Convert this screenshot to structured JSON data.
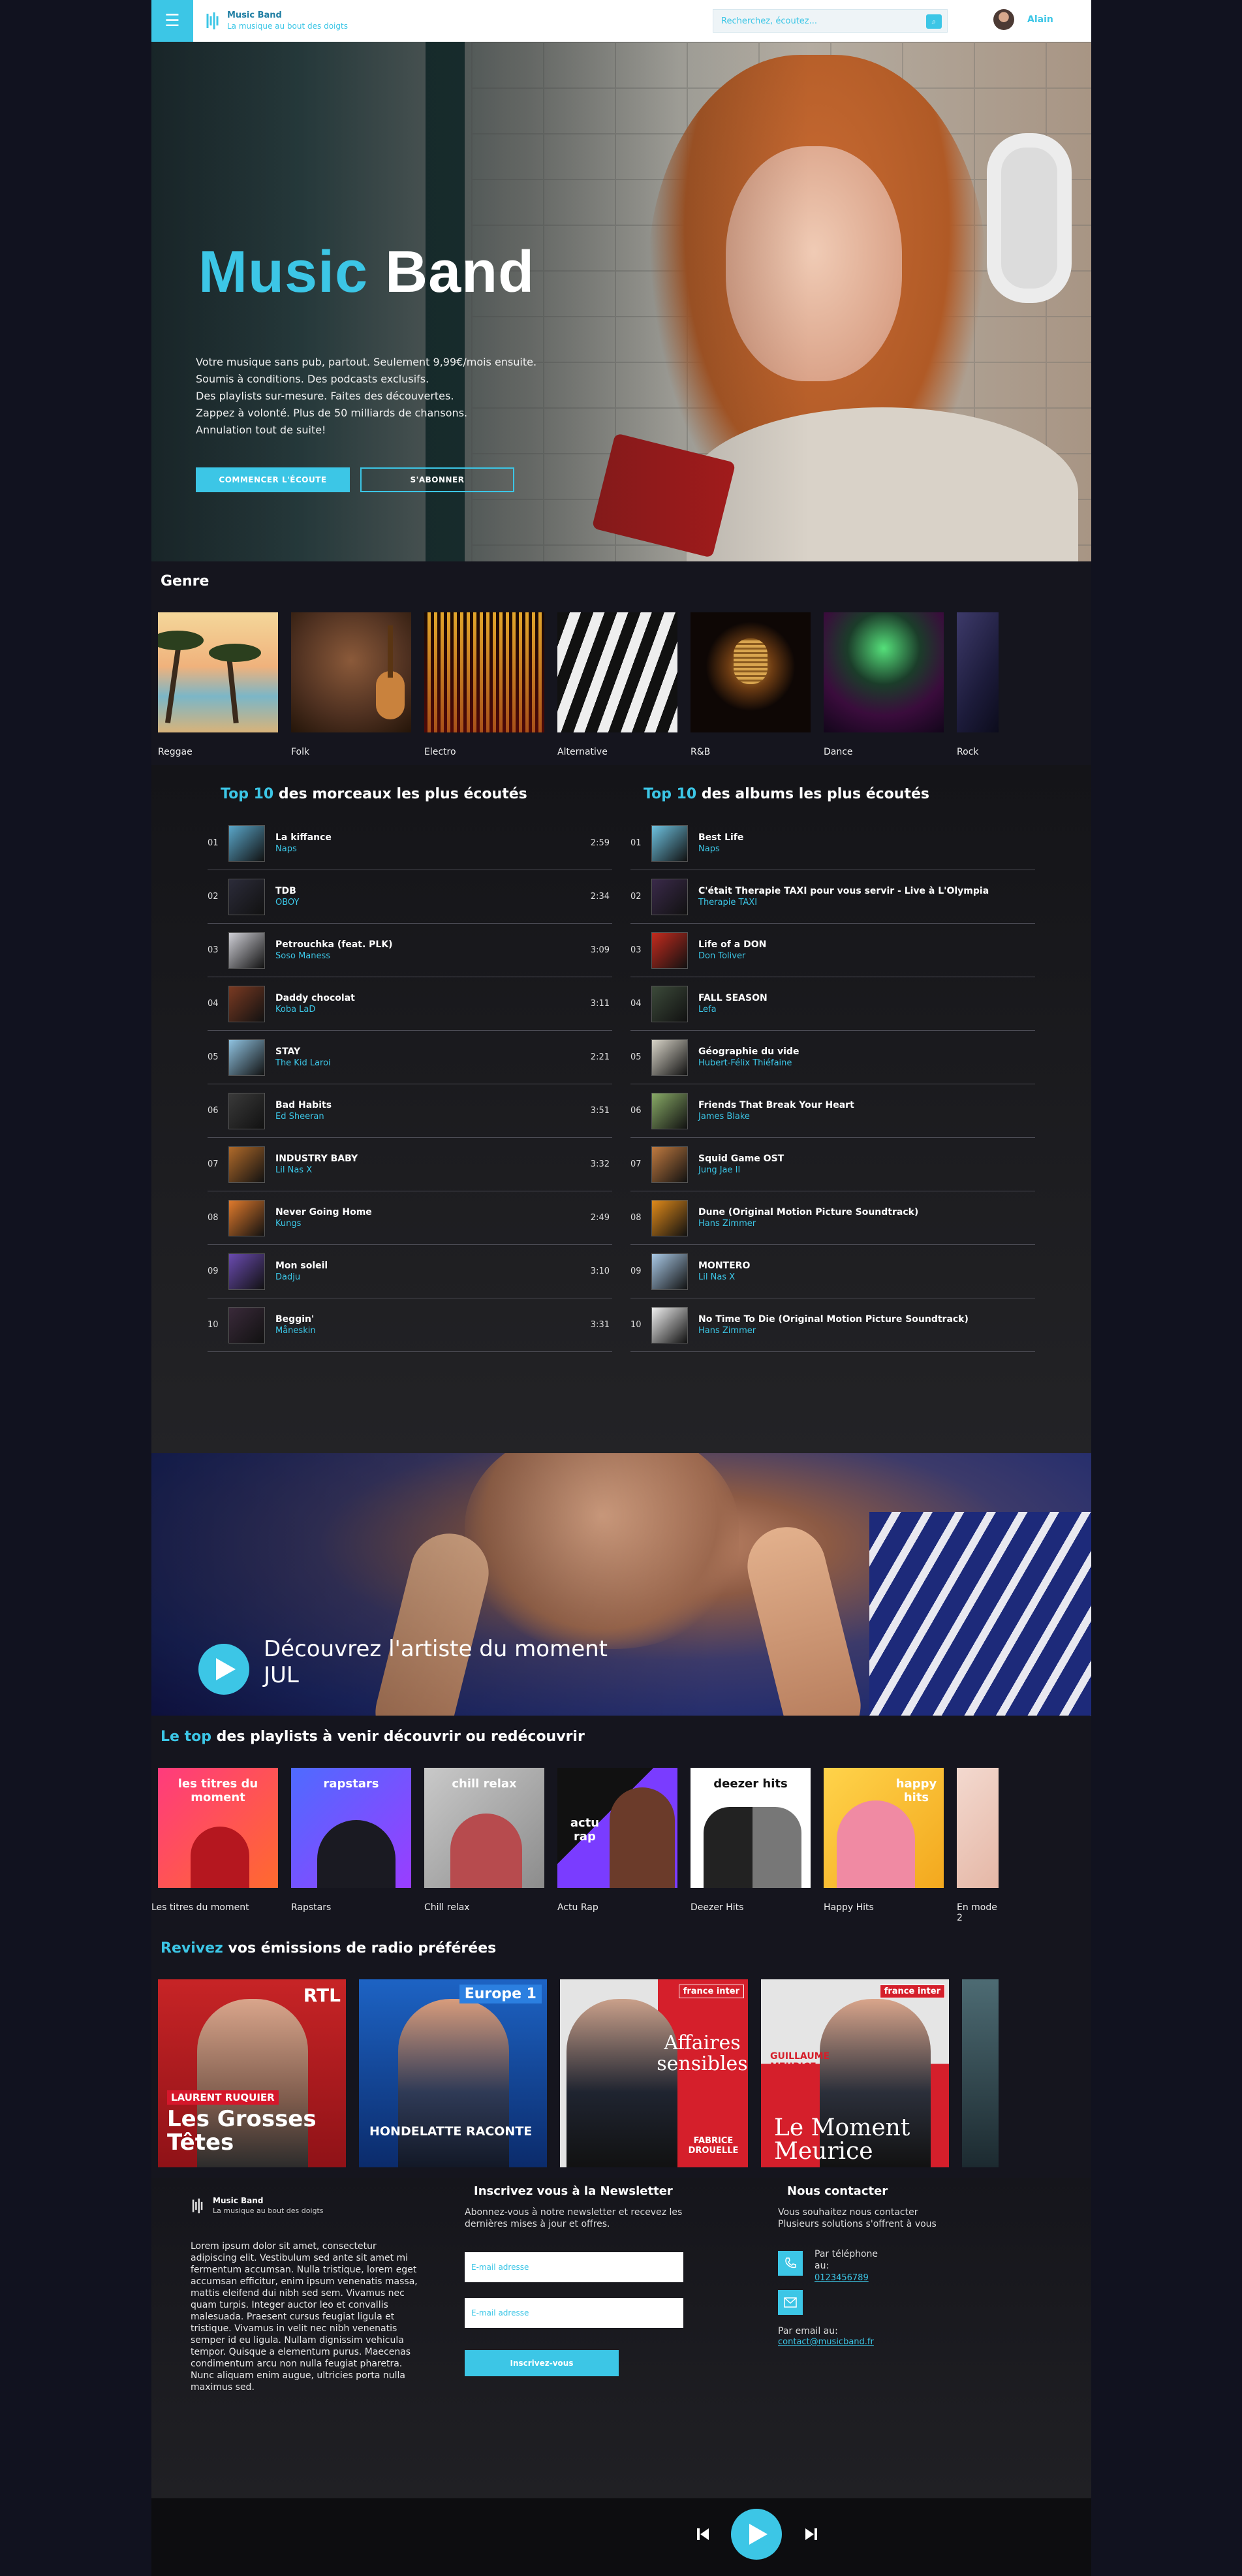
{
  "header": {
    "menu_icon": "hamburger-icon",
    "logo_title": "Music Band",
    "logo_subtitle": "La musique au bout des doigts",
    "search_placeholder": "Recherchez, écoutez...",
    "user_name": "Alain",
    "accent": "#3cc6e6"
  },
  "hero": {
    "title_part1": "Music",
    "title_part2": "Band",
    "lines": [
      "Votre musique sans pub, partout. Seulement 9,99€/mois ensuite.",
      "Soumis à conditions. Des podcasts exclusifs.",
      "Des playlists sur-mesure. Faites des découvertes.",
      "Zappez à volonté. Plus de 50 milliards de chansons.",
      "Annulation tout de suite!"
    ],
    "btn_listen": "COMMENCER L'ÉCOUTE",
    "btn_subscribe": "S'ABONNER"
  },
  "genre": {
    "title": "Genre",
    "items": [
      "Reggae",
      "Folk",
      "Electro",
      "Alternative",
      "R&B",
      "Dance",
      "Rock"
    ]
  },
  "top_tracks": {
    "title_accent": "Top 10",
    "title_rest": "des morceaux les plus écoutés",
    "items": [
      {
        "num": "01",
        "name": "La kiffance",
        "artist": "Naps",
        "duration": "2:59"
      },
      {
        "num": "02",
        "name": "TDB",
        "artist": "OBOY",
        "duration": "2:34"
      },
      {
        "num": "03",
        "name": "Petrouchka (feat. PLK)",
        "artist": "Soso Maness",
        "duration": "3:09"
      },
      {
        "num": "04",
        "name": "Daddy chocolat",
        "artist": "Koba LaD",
        "duration": "3:11"
      },
      {
        "num": "05",
        "name": "STAY",
        "artist": "The Kid Laroi",
        "duration": "2:21"
      },
      {
        "num": "06",
        "name": "Bad Habits",
        "artist": "Ed Sheeran",
        "duration": "3:51"
      },
      {
        "num": "07",
        "name": "INDUSTRY BABY",
        "artist": "Lil Nas X",
        "duration": "3:32"
      },
      {
        "num": "08",
        "name": "Never Going Home",
        "artist": "Kungs",
        "duration": "2:49"
      },
      {
        "num": "09",
        "name": "Mon soleil",
        "artist": "Dadju",
        "duration": "3:10"
      },
      {
        "num": "10",
        "name": "Beggin'",
        "artist": "Måneskin",
        "duration": "3:31"
      }
    ]
  },
  "top_albums": {
    "title_accent": "Top 10",
    "title_rest": "des albums les plus écoutés",
    "items": [
      {
        "num": "01",
        "name": "Best Life",
        "artist": "Naps"
      },
      {
        "num": "02",
        "name": "C'était Therapie TAXI pour vous servir - Live à L'Olympia",
        "artist": "Therapie TAXI"
      },
      {
        "num": "03",
        "name": "Life of a DON",
        "artist": "Don Toliver"
      },
      {
        "num": "04",
        "name": "FALL SEASON",
        "artist": "Lefa"
      },
      {
        "num": "05",
        "name": "Géographie du vide",
        "artist": "Hubert-Félix Thiéfaine"
      },
      {
        "num": "06",
        "name": "Friends That Break Your Heart",
        "artist": "James Blake"
      },
      {
        "num": "07",
        "name": "Squid Game OST",
        "artist": "Jung Jae Il"
      },
      {
        "num": "08",
        "name": "Dune (Original Motion Picture Soundtrack)",
        "artist": "Hans Zimmer"
      },
      {
        "num": "09",
        "name": "MONTERO",
        "artist": "Lil Nas X"
      },
      {
        "num": "10",
        "name": "No Time To Die (Original Motion Picture Soundtrack)",
        "artist": "Hans Zimmer"
      }
    ]
  },
  "artist": {
    "line1": "Découvrez l'artiste du moment",
    "line2": "JUL"
  },
  "playlists": {
    "title_accent": "Le top",
    "title_rest": "des playlists à venir découvrir ou redécouvrir",
    "items": [
      {
        "label": "Les titres du moment",
        "art_text": "les titres du moment"
      },
      {
        "label": "Rapstars",
        "art_text": "rapstars"
      },
      {
        "label": "Chill relax",
        "art_text": "chill relax"
      },
      {
        "label": "Actu Rap",
        "art_text": "actu rap"
      },
      {
        "label": "Deezer Hits",
        "art_text": "deezer hits"
      },
      {
        "label": "Happy Hits",
        "art_text": "happy hits"
      },
      {
        "label": "En mode 2",
        "art_text": ""
      }
    ]
  },
  "radio": {
    "title_accent": "Revivez",
    "title_rest": "vos émissions de radio préférées",
    "items": [
      {
        "station": "RTL",
        "host": "LAURENT RUQUIER",
        "show": "Les Grosses Têtes"
      },
      {
        "station": "Europe 1",
        "host": "",
        "show": "HONDELATTE RACONTE"
      },
      {
        "station": "france inter",
        "host": "FABRICE DROUELLE",
        "show": "Affaires sensibles"
      },
      {
        "station": "france inter",
        "host": "GUILLAUME MEURICE",
        "show": "Le Moment Meurice"
      }
    ]
  },
  "footer": {
    "logo_title": "Music Band",
    "logo_subtitle": "La musique au bout des doigts",
    "about": "Lorem ipsum dolor sit amet, consectetur adipiscing elit. Vestibulum sed ante sit amet mi fermentum accumsan. Nulla tristique, lorem eget accumsan efficitur, enim ipsum venenatis massa, mattis eleifend dui nibh sed sem. Vivamus nec quam turpis. Integer auctor leo et convallis malesuada. Praesent cursus feugiat ligula et tristique. Vivamus in velit nec nibh venenatis semper id eu ligula. Nullam dignissim vehicula tempor. Quisque a elementum purus. Maecenas condimentum arcu non nulla feugiat pharetra. Nunc aliquam enim augue, ultricies porta nulla maximus sed.",
    "newsletter_title": "Inscrivez vous à la Newsletter",
    "newsletter_text": "Abonnez-vous à notre newsletter et recevez les dernières mises à jour et offres.",
    "email_placeholder_1": "E-mail adresse",
    "email_placeholder_2": "E-mail adresse",
    "newsletter_btn": "Inscrivez-vous",
    "contact_title": "Nous contacter",
    "contact_text": "Vous souhaitez nous contacter Plusieurs solutions s'offrent à vous",
    "phone_label": "Par téléphone au:",
    "phone_link": "0123456789",
    "email_label": "Par email au:",
    "email_link": "contact@musicband.fr"
  },
  "player": {
    "prev_icon": "skip-previous-icon",
    "play_icon": "play-icon",
    "next_icon": "skip-next-icon"
  }
}
